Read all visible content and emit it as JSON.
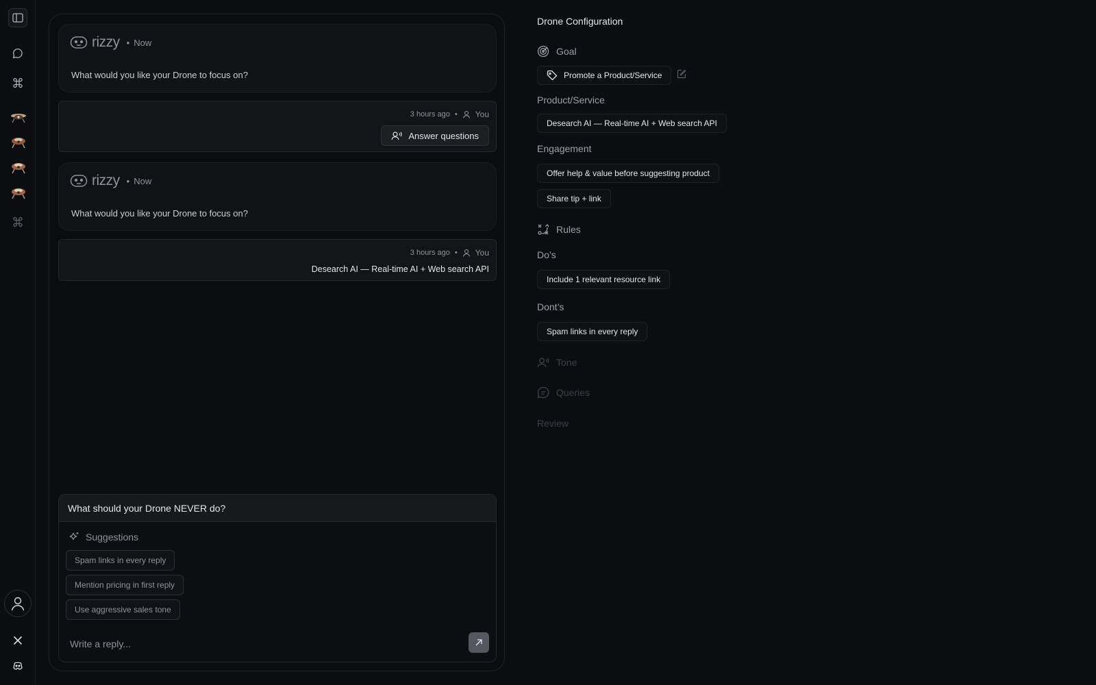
{
  "rail": {
    "toggle_icon": "sidebar-toggle-icon",
    "items": [
      "chat-icon",
      "command-icon",
      "drone-1",
      "drone-2",
      "drone-3",
      "drone-4",
      "command-icon-dim"
    ],
    "bottom": [
      "user-icon",
      "x-logo-icon",
      "discord-icon"
    ]
  },
  "chat": {
    "messages": [
      {
        "type": "bot",
        "name": "rizzy",
        "sep": "•",
        "time": "Now",
        "text": "What would you like your Drone to focus on?"
      },
      {
        "type": "user",
        "time": "3 hours ago",
        "sep": "•",
        "author": "You",
        "button_label": "Answer questions"
      },
      {
        "type": "bot",
        "name": "rizzy",
        "sep": "•",
        "time": "Now",
        "text": "What would you like your Drone to focus on?"
      },
      {
        "type": "user",
        "time": "3 hours ago",
        "sep": "•",
        "author": "You",
        "text": "Desearch AI — Real-time AI + Web search API"
      }
    ],
    "composer": {
      "question": "What should your Drone NEVER do?",
      "suggestions_label": "Suggestions",
      "suggestions": [
        "Spam links in every reply",
        "Mention pricing in first reply",
        "Use aggressive sales tone"
      ],
      "placeholder": "Write a reply..."
    }
  },
  "config": {
    "title": "Drone Configuration",
    "goal": {
      "label": "Goal",
      "value": "Promote a Product/Service"
    },
    "product": {
      "label": "Product/Service",
      "value": "Desearch AI — Real-time AI + Web search API"
    },
    "engagement": {
      "label": "Engagement",
      "values": [
        "Offer help & value before suggesting product",
        "Share tip + link"
      ]
    },
    "rules": {
      "label": "Rules"
    },
    "dos": {
      "label": "Do’s",
      "values": [
        "Include 1 relevant resource link"
      ]
    },
    "donts": {
      "label": "Dont’s",
      "values": [
        "Spam links in every reply"
      ]
    },
    "tone": {
      "label": "Tone"
    },
    "queries": {
      "label": "Queries"
    },
    "review": {
      "label": "Review"
    }
  },
  "colors": {
    "background": "#0c0d10",
    "panel": "#111216",
    "muted": "#8d939b",
    "dim": "#3c4047"
  }
}
